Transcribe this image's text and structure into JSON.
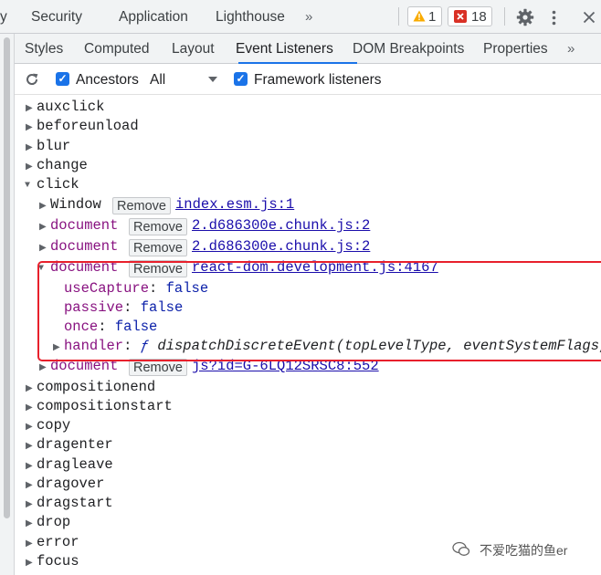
{
  "top_tabs": [
    "y",
    "Security",
    "Application",
    "Lighthouse"
  ],
  "warnings_count": "1",
  "errors_count": "18",
  "sub_tabs": [
    "Styles",
    "Computed",
    "Layout",
    "Event Listeners",
    "DOM Breakpoints",
    "Properties"
  ],
  "toolbar": {
    "ancestors_label": "Ancestors",
    "filter_value": "All",
    "framework_label": "Framework listeners"
  },
  "remove_label": "Remove",
  "events_before": [
    "auxclick",
    "beforeunload",
    "blur",
    "change"
  ],
  "expanded_event": "click",
  "listeners": [
    {
      "target": "Window",
      "source": "index.esm.js:1"
    },
    {
      "target": "document",
      "source": "2.d686300e.chunk.js:2"
    },
    {
      "target": "document",
      "source": "2.d686300e.chunk.js:2"
    },
    {
      "target": "document",
      "source": "react-dom.development.js:4167"
    },
    {
      "target": "document",
      "source": "js?id=G-6LQ12SRSC8:552"
    }
  ],
  "details": {
    "use_capture_key": "useCapture",
    "use_capture_val": "false",
    "passive_key": "passive",
    "passive_val": "false",
    "once_key": "once",
    "once_val": "false",
    "handler_key": "handler",
    "handler_f": "ƒ",
    "handler_sig": "dispatchDiscreteEvent(topLevelType, eventSystemFlags,"
  },
  "events_after": [
    "compositionend",
    "compositionstart",
    "copy",
    "dragenter",
    "dragleave",
    "dragover",
    "dragstart",
    "drop",
    "error",
    "focus"
  ],
  "watermark": "不爱吃猫的鱼er",
  "colors": {
    "accent": "#1a73e8",
    "highlight": "#e8202c",
    "link": "#1a0dab",
    "dom_node": "#881280"
  }
}
